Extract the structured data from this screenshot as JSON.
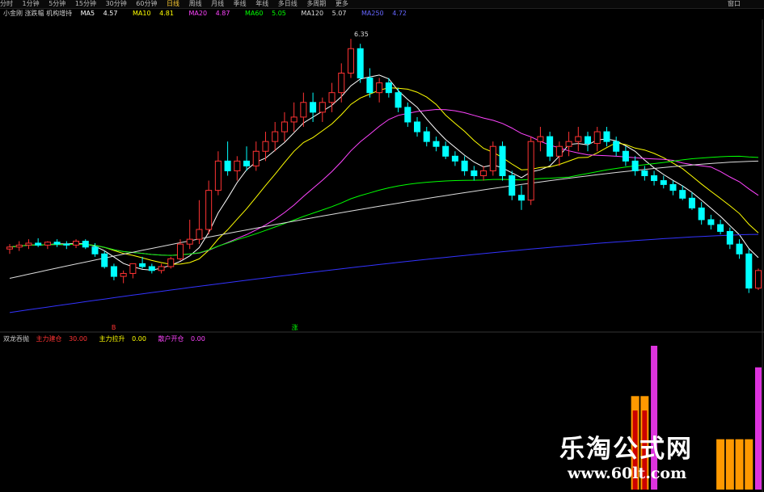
{
  "toolbar": {
    "items": [
      "分时",
      "1分钟",
      "5分钟",
      "15分钟",
      "30分钟",
      "60分钟",
      "日线",
      "周线",
      "月线",
      "季线",
      "年线",
      "多日线",
      "多周期",
      "更多"
    ],
    "active_index": 6,
    "right_label": "窗口"
  },
  "ma_legend": {
    "title": "小金刚 涨跌幅 机构增持",
    "items": [
      {
        "label": "MA5",
        "value": "4.57",
        "color": "#ffffff"
      },
      {
        "label": "MA10",
        "value": "4.81",
        "color": "#ffff00"
      },
      {
        "label": "MA20",
        "value": "4.87",
        "color": "#ff44ff"
      },
      {
        "label": "MA60",
        "value": "5.05",
        "color": "#00ff00"
      },
      {
        "label": "MA120",
        "value": "5.07",
        "color": "#dddddd"
      },
      {
        "label": "MA250",
        "value": "4.72",
        "color": "#3333ff"
      }
    ]
  },
  "indicator_legend": {
    "title": "双龙吞抛",
    "items": [
      {
        "label": "主力建仓",
        "value": "30.00",
        "color": "#ff3333"
      },
      {
        "label": "主力拉升",
        "value": "0.00",
        "color": "#ffff00"
      },
      {
        "label": "散户开仓",
        "value": "0.00",
        "color": "#ff44ff"
      }
    ]
  },
  "chart_data": {
    "type": "candlestick",
    "price_range": [
      3.4,
      6.5
    ],
    "high_annotation": "6.35",
    "candles": [
      [
        4.2,
        4.25,
        4.15,
        4.22
      ],
      [
        4.22,
        4.28,
        4.18,
        4.24
      ],
      [
        4.24,
        4.3,
        4.2,
        4.26
      ],
      [
        4.26,
        4.31,
        4.22,
        4.24
      ],
      [
        4.24,
        4.28,
        4.2,
        4.27
      ],
      [
        4.27,
        4.3,
        4.22,
        4.25
      ],
      [
        4.25,
        4.28,
        4.2,
        4.24
      ],
      [
        4.24,
        4.3,
        4.21,
        4.28
      ],
      [
        4.28,
        4.3,
        4.2,
        4.22
      ],
      [
        4.22,
        4.26,
        4.12,
        4.15
      ],
      [
        4.15,
        4.18,
        4.0,
        4.02
      ],
      [
        4.02,
        4.05,
        3.88,
        3.92
      ],
      [
        3.92,
        3.98,
        3.85,
        3.95
      ],
      [
        3.95,
        4.05,
        3.9,
        4.05
      ],
      [
        4.05,
        4.12,
        4.0,
        4.02
      ],
      [
        4.02,
        4.05,
        3.95,
        3.98
      ],
      [
        3.98,
        4.05,
        3.95,
        4.02
      ],
      [
        4.02,
        4.12,
        4.0,
        4.1
      ],
      [
        4.1,
        4.3,
        4.08,
        4.25
      ],
      [
        4.25,
        4.5,
        4.2,
        4.3
      ],
      [
        4.3,
        4.7,
        4.25,
        4.4
      ],
      [
        4.4,
        4.9,
        4.35,
        4.8
      ],
      [
        4.8,
        5.2,
        4.75,
        5.1
      ],
      [
        5.1,
        5.3,
        4.95,
        5.0
      ],
      [
        5.0,
        5.15,
        4.9,
        5.1
      ],
      [
        5.1,
        5.25,
        5.0,
        5.05
      ],
      [
        5.05,
        5.3,
        5.0,
        5.2
      ],
      [
        5.2,
        5.4,
        5.1,
        5.3
      ],
      [
        5.3,
        5.5,
        5.2,
        5.4
      ],
      [
        5.4,
        5.6,
        5.3,
        5.5
      ],
      [
        5.5,
        5.7,
        5.4,
        5.55
      ],
      [
        5.55,
        5.8,
        5.45,
        5.7
      ],
      [
        5.7,
        5.8,
        5.5,
        5.6
      ],
      [
        5.6,
        5.75,
        5.5,
        5.7
      ],
      [
        5.7,
        5.9,
        5.6,
        5.8
      ],
      [
        5.8,
        6.1,
        5.7,
        6.0
      ],
      [
        6.0,
        6.35,
        5.95,
        6.25
      ],
      [
        6.25,
        6.3,
        5.9,
        5.95
      ],
      [
        5.95,
        6.05,
        5.75,
        5.8
      ],
      [
        5.8,
        5.95,
        5.7,
        5.9
      ],
      [
        5.9,
        5.95,
        5.75,
        5.8
      ],
      [
        5.8,
        5.85,
        5.6,
        5.65
      ],
      [
        5.65,
        5.7,
        5.45,
        5.5
      ],
      [
        5.5,
        5.55,
        5.35,
        5.4
      ],
      [
        5.4,
        5.45,
        5.25,
        5.3
      ],
      [
        5.3,
        5.35,
        5.2,
        5.25
      ],
      [
        5.25,
        5.3,
        5.12,
        5.15
      ],
      [
        5.15,
        5.2,
        5.05,
        5.1
      ],
      [
        5.1,
        5.15,
        4.95,
        5.0
      ],
      [
        5.0,
        5.05,
        4.9,
        4.95
      ],
      [
        4.95,
        5.05,
        4.9,
        5.0
      ],
      [
        5.0,
        5.3,
        4.95,
        5.25
      ],
      [
        5.25,
        5.3,
        4.9,
        4.95
      ],
      [
        4.95,
        5.0,
        4.7,
        4.75
      ],
      [
        4.75,
        4.85,
        4.6,
        4.7
      ],
      [
        4.7,
        5.35,
        4.65,
        5.3
      ],
      [
        5.3,
        5.45,
        5.2,
        5.35
      ],
      [
        5.35,
        5.4,
        5.1,
        5.15
      ],
      [
        5.15,
        5.3,
        5.05,
        5.25
      ],
      [
        5.25,
        5.4,
        5.15,
        5.3
      ],
      [
        5.3,
        5.45,
        5.2,
        5.35
      ],
      [
        5.35,
        5.4,
        5.2,
        5.28
      ],
      [
        5.28,
        5.45,
        5.2,
        5.4
      ],
      [
        5.4,
        5.45,
        5.25,
        5.3
      ],
      [
        5.3,
        5.35,
        5.15,
        5.2
      ],
      [
        5.2,
        5.25,
        5.05,
        5.1
      ],
      [
        5.1,
        5.15,
        4.95,
        5.0
      ],
      [
        5.0,
        5.05,
        4.9,
        4.95
      ],
      [
        4.95,
        5.0,
        4.85,
        4.9
      ],
      [
        4.9,
        4.95,
        4.82,
        4.86
      ],
      [
        4.86,
        4.9,
        4.75,
        4.8
      ],
      [
        4.8,
        4.85,
        4.7,
        4.72
      ],
      [
        4.72,
        4.78,
        4.6,
        4.62
      ],
      [
        4.62,
        4.68,
        4.45,
        4.5
      ],
      [
        4.5,
        4.55,
        4.4,
        4.45
      ],
      [
        4.45,
        4.5,
        4.35,
        4.38
      ],
      [
        4.38,
        4.42,
        4.2,
        4.25
      ],
      [
        4.25,
        4.3,
        4.1,
        4.15
      ],
      [
        4.15,
        4.2,
        3.75,
        3.8
      ],
      [
        3.8,
        4.0,
        3.78,
        3.98
      ]
    ]
  },
  "indicator_bars": [
    {
      "index": 66,
      "orange": 0.65,
      "red": 0.55
    },
    {
      "index": 67,
      "orange": 0.65,
      "red": 0.55
    },
    {
      "index": 68,
      "magenta": 1.0
    },
    {
      "index": 75,
      "orange": 0.35
    },
    {
      "index": 76,
      "orange": 0.35
    },
    {
      "index": 77,
      "orange": 0.35
    },
    {
      "index": 78,
      "orange": 0.35
    },
    {
      "index": 79,
      "magenta": 0.85
    }
  ],
  "markers": [
    {
      "text": "B",
      "color": "#ff3333",
      "index": 11
    },
    {
      "text": "涨",
      "color": "#00ff00",
      "index": 30
    }
  ],
  "watermark": {
    "title": "乐淘公式网",
    "url": "www.60lt.com"
  }
}
